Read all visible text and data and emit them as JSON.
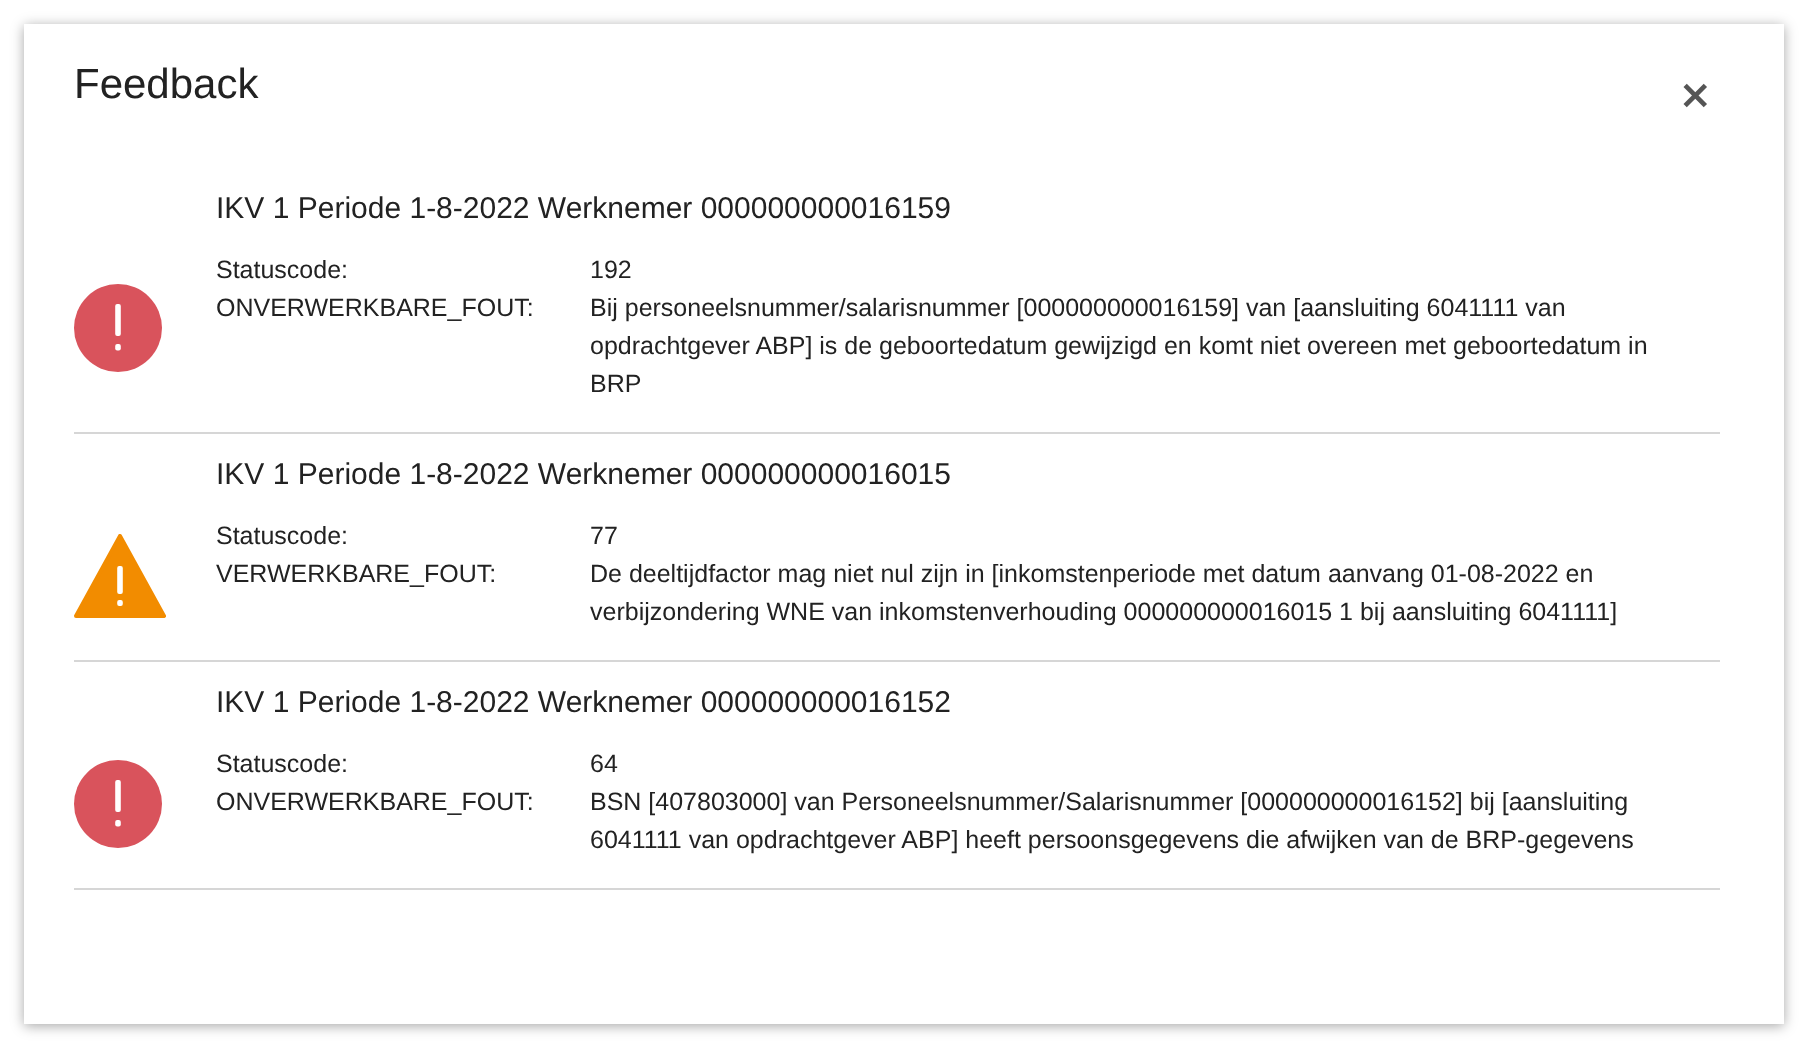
{
  "dialog": {
    "title": "Feedback",
    "close": "×"
  },
  "messages": [
    {
      "kind": "error",
      "title": "IKV 1 Periode 1-8-2022 Werknemer 000000000016159",
      "rows": [
        {
          "label": "Statuscode:",
          "value": "192"
        },
        {
          "label": "ONVERWERKBARE_FOUT:",
          "value": "Bij personeelsnummer/salarisnummer [000000000016159] van [aansluiting 6041111 van opdrachtgever ABP] is de geboortedatum gewijzigd en komt niet overeen met geboortedatum in BRP"
        }
      ]
    },
    {
      "kind": "warning",
      "title": "IKV 1 Periode 1-8-2022 Werknemer 000000000016015",
      "rows": [
        {
          "label": "Statuscode:",
          "value": "77"
        },
        {
          "label": "VERWERKBARE_FOUT:",
          "value": "De deeltijdfactor mag niet nul zijn in [inkomstenperiode met datum aanvang 01-08-2022 en verbijzondering WNE van inkomstenverhouding 000000000016015 1 bij aansluiting 6041111]"
        }
      ]
    },
    {
      "kind": "error",
      "title": "IKV 1 Periode 1-8-2022 Werknemer 000000000016152",
      "rows": [
        {
          "label": "Statuscode:",
          "value": "64"
        },
        {
          "label": "ONVERWERKBARE_FOUT:",
          "value": "BSN [407803000] van Personeelsnummer/Salarisnummer [000000000016152] bij [aansluiting 6041111 van opdrachtgever ABP] heeft persoonsgegevens die afwijken van de BRP-gegevens"
        }
      ]
    }
  ]
}
